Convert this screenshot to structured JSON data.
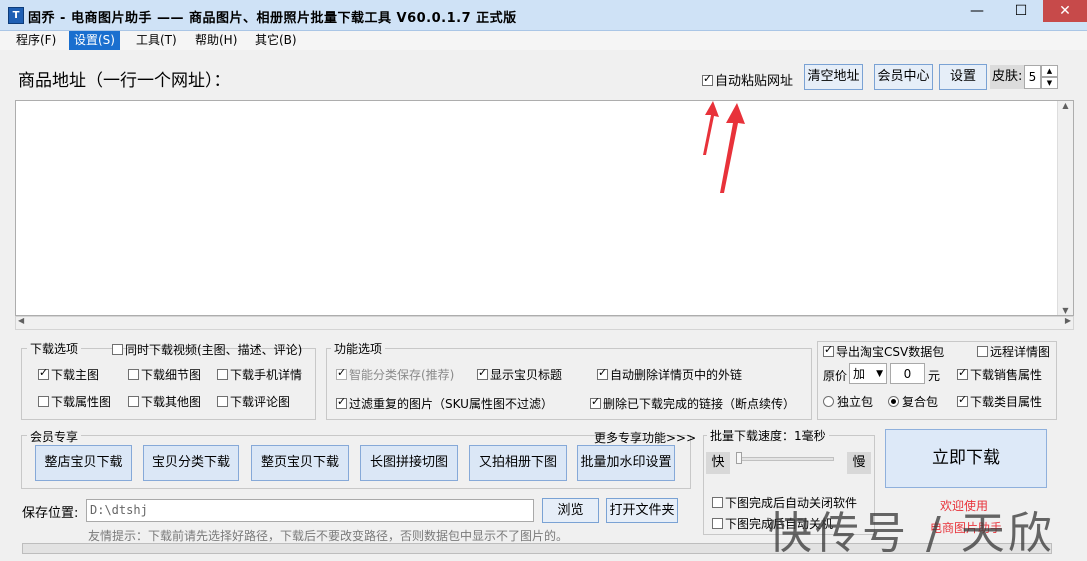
{
  "window": {
    "app_icon_letter": "T",
    "title": "固乔 - 电商图片助手 —— 商品图片、相册照片批量下载工具 V60.0.1.7 正式版",
    "minimize": "—",
    "maximize": "☐",
    "close": "✕"
  },
  "menu": {
    "items": [
      "程序(F)",
      "设置(S)",
      "工具(T)",
      "帮助(H)",
      "其它(B)"
    ],
    "active_index": 1
  },
  "header": {
    "url_label": "商品地址（一行一个网址）：",
    "auto_paste_label": "自动粘贴网址",
    "clear_button": "清空地址",
    "member_button": "会员中心",
    "settings_button": "设置",
    "skin_label": "皮肤:",
    "skin_value": "5"
  },
  "download_options": {
    "legend": "下载选项",
    "video_label": "同时下载视频(主图、描述、评论)",
    "options": [
      {
        "label": "下载主图",
        "checked": true
      },
      {
        "label": "下载细节图",
        "checked": false
      },
      {
        "label": "下载手机详情",
        "checked": false
      },
      {
        "label": "下载属性图",
        "checked": false
      },
      {
        "label": "下载其他图",
        "checked": false
      },
      {
        "label": "下载评论图",
        "checked": false
      }
    ]
  },
  "function_options": {
    "legend": "功能选项",
    "options": [
      {
        "label": "智能分类保存(推荐)",
        "checked": true,
        "disabled": true
      },
      {
        "label": "显示宝贝标题",
        "checked": true
      },
      {
        "label": "自动删除详情页中的外链",
        "checked": true
      },
      {
        "label": "过滤重复的图片（SKU属性图不过滤）",
        "checked": true
      },
      {
        "label": "删除已下载完成的链接（断点续传）",
        "checked": true
      }
    ]
  },
  "csv_options": {
    "export_csv_label": "导出淘宝CSV数据包",
    "remote_detail_label": "远程详情图",
    "price_label": "原价",
    "price_op": "加",
    "price_value": "0",
    "price_unit": "元",
    "sales_attr_label": "下载销售属性",
    "independent_label": "独立包",
    "composite_label": "复合包",
    "category_attr_label": "下载类目属性"
  },
  "member": {
    "legend": "会员专享",
    "more_link": "更多专享功能>>>",
    "buttons": [
      "整店宝贝下载",
      "宝贝分类下载",
      "整页宝贝下载",
      "长图拼接切图",
      "又拍相册下图",
      "批量加水印设置"
    ]
  },
  "speed": {
    "legend": "批量下载速度：1毫秒",
    "fast": "快",
    "slow": "慢",
    "slider_fraction": 0.0,
    "close_app_label": "下图完成后自动关闭软件",
    "shutdown_label": "下图完成后自动关机"
  },
  "download_button": "立即下载",
  "welcome": {
    "line1": "欢迎使用",
    "line2": "电商图片助手"
  },
  "save": {
    "label": "保存位置:",
    "path": "D:\\dtshj",
    "browse_button": "浏览",
    "open_folder_button": "打开文件夹",
    "tip": "友情提示：下载前请先选择好路径，下载后不要改变路径，否则数据包中显示不了图片的。"
  },
  "watermark": "快传号 / 天欣",
  "colors": {
    "accent": "#1a6fcf",
    "arrow": "#e8323a",
    "welcome": "#e8323a"
  }
}
